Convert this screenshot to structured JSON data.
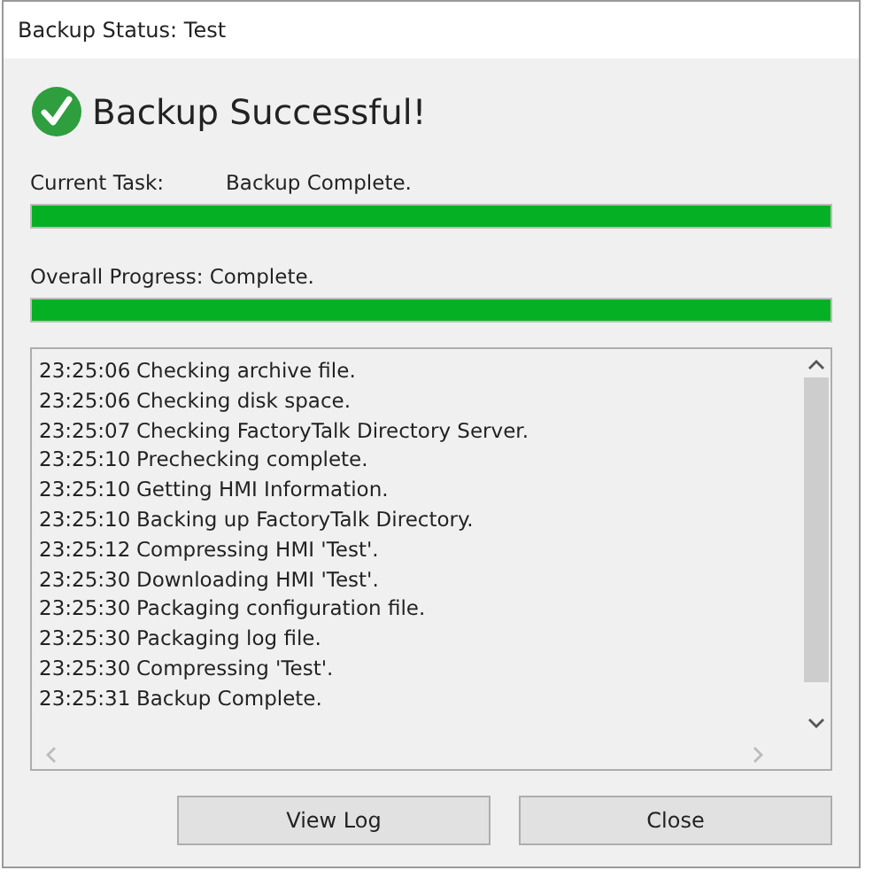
{
  "window": {
    "title": "Backup Status: Test"
  },
  "status": {
    "kind": "success",
    "message": "Backup Successful!"
  },
  "current_task": {
    "label": "Current Task:",
    "value": "Backup Complete.",
    "level": 1
  },
  "overall_progress": {
    "label": "Overall Progress: Complete.",
    "level": 1
  },
  "log": [
    {
      "time": "23:25:06",
      "message": "Checking archive file."
    },
    {
      "time": "23:25:06",
      "message": "Checking disk space."
    },
    {
      "time": "23:25:07",
      "message": "Checking FactoryTalk Directory Server."
    },
    {
      "time": "23:25:10",
      "message": "Prechecking complete."
    },
    {
      "time": "23:25:10",
      "message": "Getting HMI Information."
    },
    {
      "time": "23:25:10",
      "message": "Backing up FactoryTalk Directory."
    },
    {
      "time": "23:25:12",
      "message": "Compressing HMI 'Test'."
    },
    {
      "time": "23:25:30",
      "message": "Downloading HMI 'Test'."
    },
    {
      "time": "23:25:30",
      "message": "Packaging configuration file."
    },
    {
      "time": "23:25:30",
      "message": "Packaging log file."
    },
    {
      "time": "23:25:30",
      "message": "Compressing 'Test'."
    },
    {
      "time": "23:25:31",
      "message": "Backup Complete."
    }
  ],
  "buttons": [
    {
      "label": "View Log"
    },
    {
      "label": "Close"
    }
  ]
}
